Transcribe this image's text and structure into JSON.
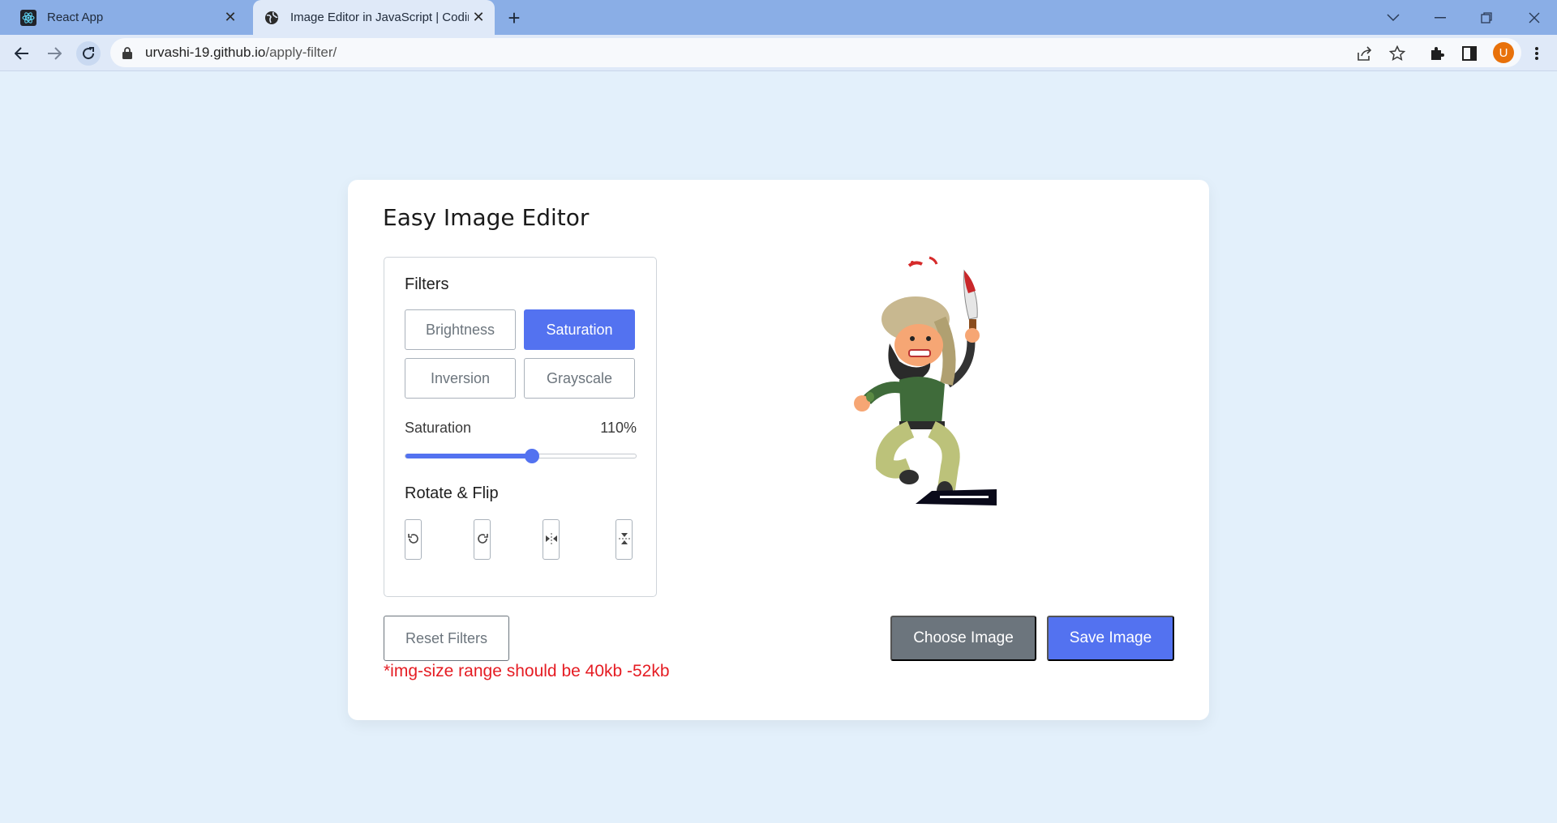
{
  "browser": {
    "tabs": [
      {
        "title": "React App",
        "icon": "react-icon"
      },
      {
        "title": "Image Editor in JavaScript | Codin",
        "icon": "globe-icon"
      }
    ],
    "url_host": "urvashi-19.github.io",
    "url_path": "/apply-filter/",
    "profile_initial": "U",
    "accent": "#8aaee6"
  },
  "editor": {
    "title": "Easy Image Editor",
    "filters_label": "Filters",
    "filters": [
      {
        "label": "Brightness",
        "active": false
      },
      {
        "label": "Saturation",
        "active": true
      },
      {
        "label": "Inversion",
        "active": false
      },
      {
        "label": "Grayscale",
        "active": false
      }
    ],
    "slider": {
      "name": "Saturation",
      "value_text": "110%",
      "fraction": 0.55
    },
    "rotate_label": "Rotate & Flip",
    "rotate_buttons": [
      "rotate-left-icon",
      "rotate-right-icon",
      "flip-horizontal-icon",
      "flip-vertical-icon"
    ],
    "reset_label": "Reset Filters",
    "choose_label": "Choose Image",
    "save_label": "Save Image",
    "note": "*img-size range should be 40kb -52kb",
    "accent": "#5372f0"
  }
}
